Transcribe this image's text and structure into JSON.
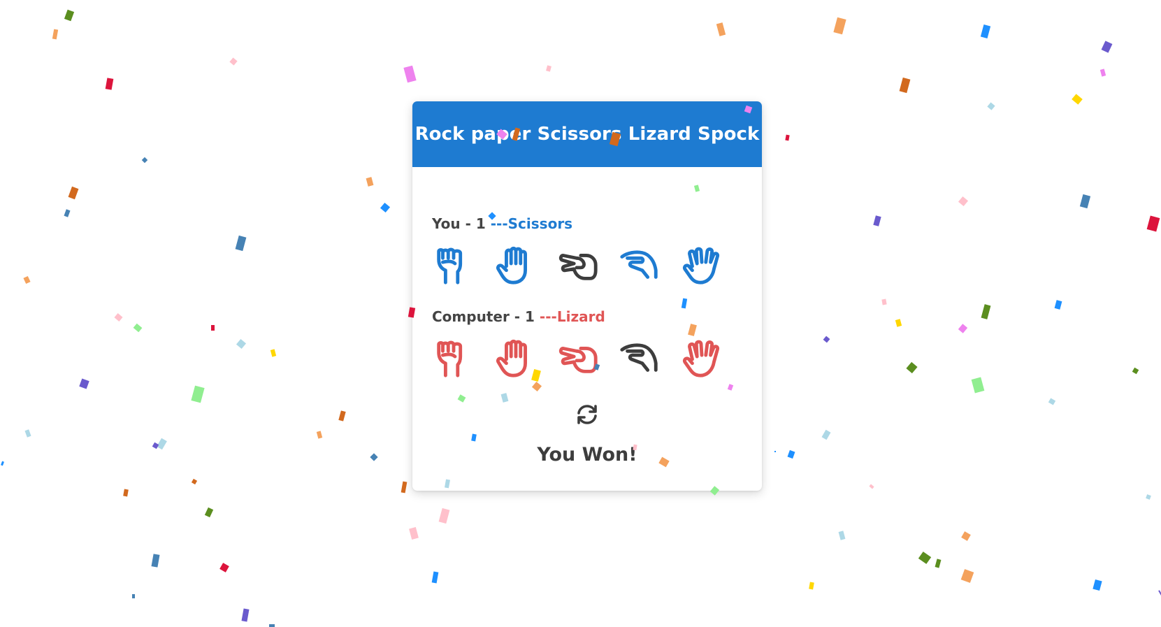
{
  "title": "Rock paper Scissors Lizard Spock",
  "player": {
    "label": "You",
    "separator": " - ",
    "score": "1",
    "pick_prefix": " ---",
    "pick": "Scissors",
    "color": "#1e7bd1",
    "selected_icon": "scissors-icon"
  },
  "computer": {
    "label": "Computer",
    "separator": " - ",
    "score": "1",
    "pick_prefix": " ---",
    "pick": "Lizard",
    "color": "#e05555",
    "selected_icon": "lizard-icon"
  },
  "choices": [
    {
      "icon": "rock-icon"
    },
    {
      "icon": "paper-icon"
    },
    {
      "icon": "scissors-icon"
    },
    {
      "icon": "lizard-icon"
    },
    {
      "icon": "spock-icon"
    }
  ],
  "replay_icon": "refresh-icon",
  "result": "You Won!",
  "colors": {
    "header": "#1e7bd1",
    "player": "#1e7bd1",
    "computer": "#e05555",
    "selected": "#3d3d3d"
  }
}
